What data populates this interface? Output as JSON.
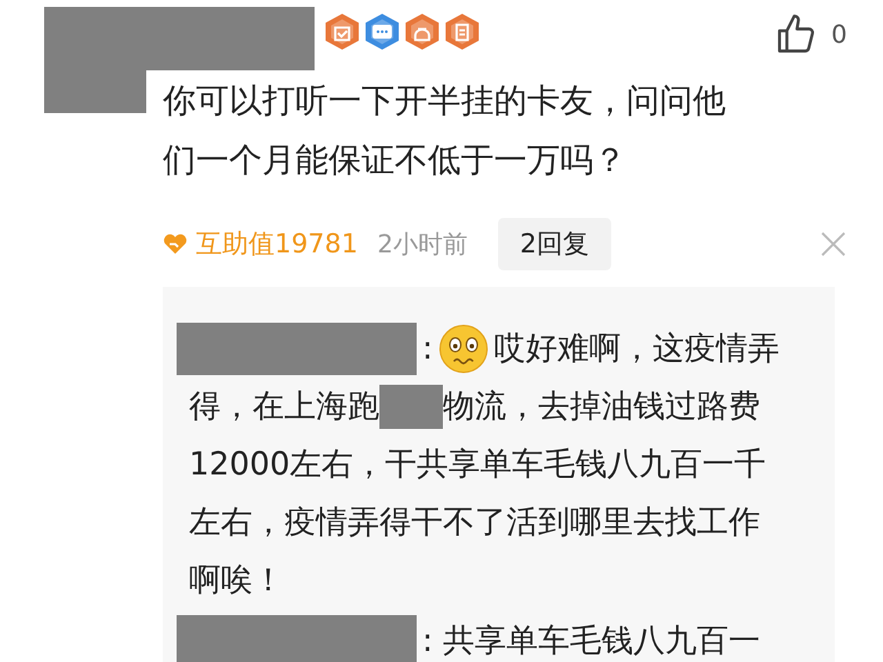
{
  "comment": {
    "like_count": "0",
    "text": "你可以打听一下开半挂的卡友，问问他们一个月能保证不低于一万吗？",
    "helpfulness": "互助值19781",
    "time": "2小时前",
    "reply_button": "2回复"
  },
  "replies": [
    {
      "lines": [
        [
          {
            "kind": "name_redaction"
          },
          {
            "kind": "text",
            "text": ":"
          },
          {
            "kind": "emoji"
          },
          {
            "kind": "text",
            "text": "哎好难啊，这疫情弄"
          }
        ],
        [
          {
            "kind": "text",
            "text": "得，在上海跑"
          },
          {
            "kind": "redaction"
          },
          {
            "kind": "text",
            "text": "物流，去掉油钱过路费"
          }
        ],
        [
          {
            "kind": "text",
            "text": "12000左右，干共享单车毛钱八九百一千"
          }
        ],
        [
          {
            "kind": "text",
            "text": "左右，疫情弄得干不了活到哪里去找工作"
          }
        ],
        [
          {
            "kind": "text",
            "text": "啊唉！"
          }
        ]
      ]
    },
    {
      "lines": [
        [
          {
            "kind": "name_redaction"
          },
          {
            "kind": "text",
            "text": ": 共享单车毛钱八九百一"
          }
        ]
      ]
    }
  ]
}
